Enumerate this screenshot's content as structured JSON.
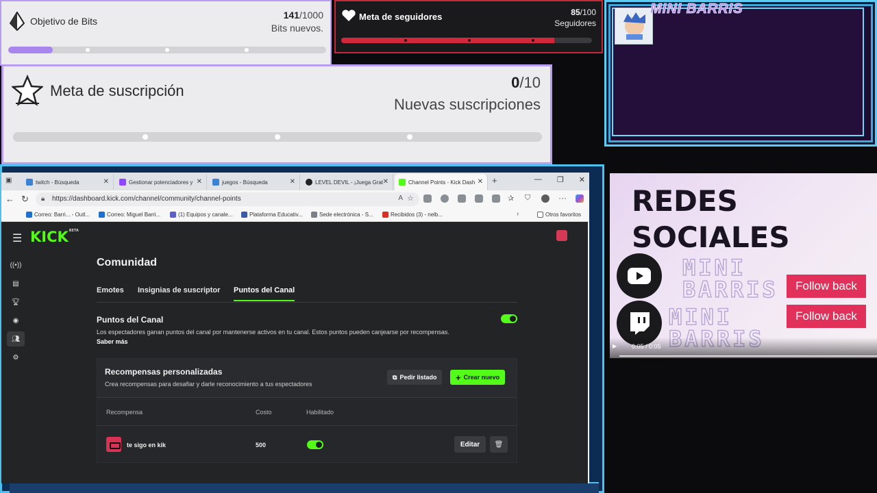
{
  "goals": {
    "bits": {
      "title": "Objetivo de Bits",
      "current": "141",
      "target": "/1000",
      "caption": "Bits nuevos.",
      "progress": 0.141
    },
    "followers": {
      "title": "Meta de seguidores",
      "current": "85",
      "target": "/100",
      "caption": "Seguidores",
      "progress": 0.85
    },
    "subs": {
      "title": "Meta de suscripción",
      "current": "0",
      "target": "/10",
      "caption": "Nuevas suscripciones",
      "progress": 0.0
    }
  },
  "overlay": {
    "channel_name": "MINI BARRIS"
  },
  "browser": {
    "tabs": [
      {
        "label": "twitch - Búsqueda",
        "color": "#3b82d6"
      },
      {
        "label": "Gestionar potenciadores y",
        "color": "#9146ff"
      },
      {
        "label": "juegos - Búsqueda",
        "color": "#3b82d6"
      },
      {
        "label": "LEVEL DEVIL - ¡Juega Grat",
        "color": "#222222"
      },
      {
        "label": "Channel Points - Kick Dash",
        "color": "#53fc18"
      }
    ],
    "url": "https://dashboard.kick.com/channel/community/channel-points",
    "bookmarks": [
      {
        "label": "Correo: Barri... - Outl...",
        "color": "#1e6fd0"
      },
      {
        "label": "Correo: Miguel Barri...",
        "color": "#1e6fd0"
      },
      {
        "label": "(1) Equipos y canale...",
        "color": "#5b5fc7"
      },
      {
        "label": "Plataforma Educativ...",
        "color": "#3c5aa8"
      },
      {
        "label": "Sede electrónica - S...",
        "color": "#7b7f86"
      },
      {
        "label": "Recibidos (3) - nelb...",
        "color": "#d93025"
      }
    ],
    "other_favorites": "Otros favoritos"
  },
  "kick": {
    "logo": "KICK",
    "logo_badge": "BETA",
    "page_title": "Comunidad",
    "tabs": [
      "Emotes",
      "Insignias de suscriptor",
      "Puntos del Canal"
    ],
    "active_tab": "Puntos del Canal",
    "channel_points": {
      "title": "Puntos del Canal",
      "description": "Los espectadores ganan puntos del canal por mantenerse activos en tu canal. Estos puntos pueden canjearse por recompensas.",
      "learn_more": "Saber más",
      "enabled": true
    },
    "rewards": {
      "title": "Recompensas personalizadas",
      "subtitle": "Crea recompensas para desafiar y darle reconocimiento a tus espectadores",
      "list_button": "Pedir listado",
      "create_button": "Crear nuevo",
      "columns": {
        "reward": "Recompensa",
        "cost": "Costo",
        "enabled": "Habilitado"
      },
      "items": [
        {
          "name": "te sigo en kik",
          "cost": "500",
          "enabled": true,
          "edit_label": "Editar"
        }
      ]
    }
  },
  "social": {
    "title": "REDES SOCIALES",
    "rows": [
      {
        "platform": "youtube",
        "handle": "MINI BARRIS",
        "button": "Follow back"
      },
      {
        "platform": "twitch",
        "handle": "MINI BARRIS",
        "button": "Follow back"
      }
    ],
    "video_time": "0:05 / 0:05"
  },
  "colors": {
    "kick_green": "#53fc18",
    "follow_red": "#e1315a",
    "goal_purple": "#a985ee",
    "follower_red": "#d2283c"
  }
}
